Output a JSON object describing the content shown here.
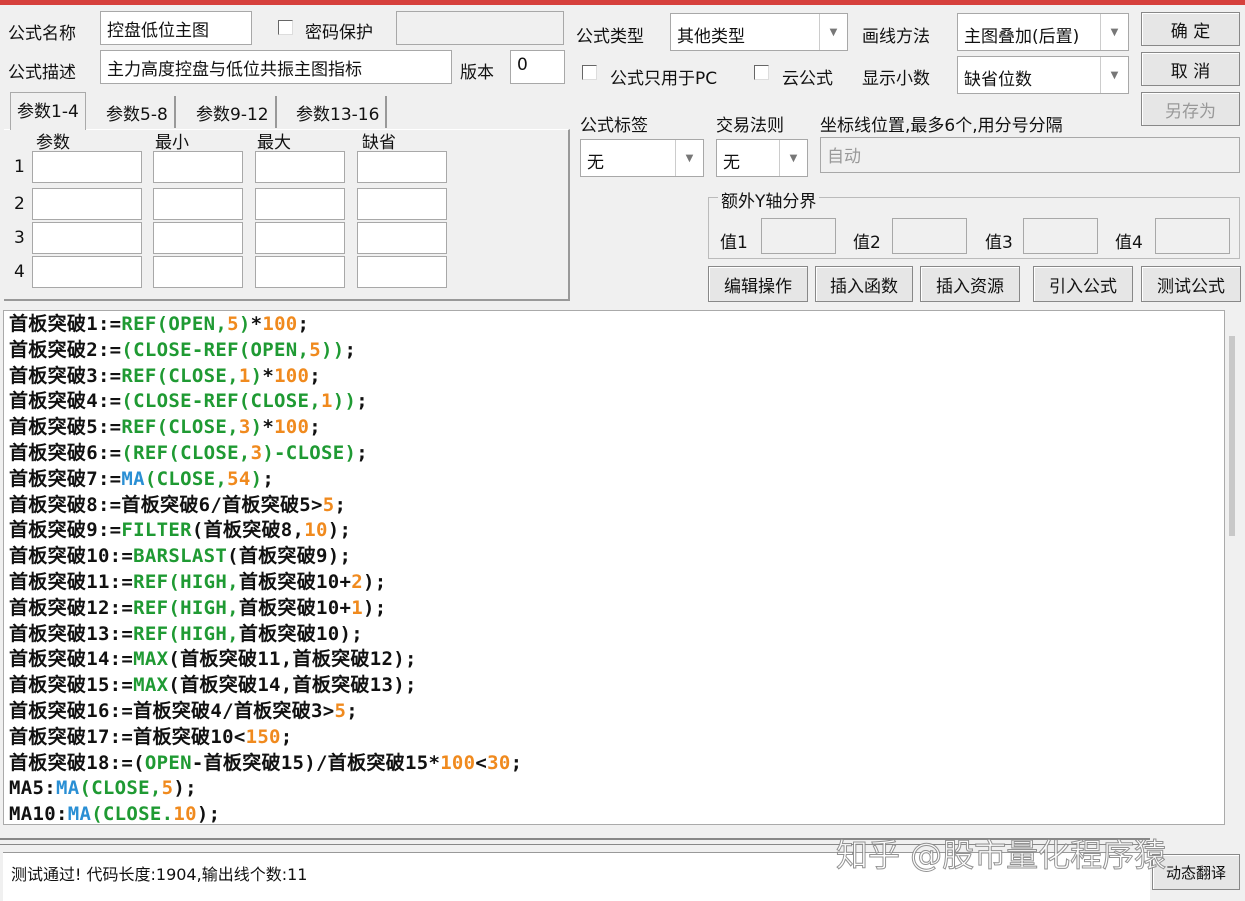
{
  "form": {
    "name_label": "公式名称",
    "name_value": "控盘低位主图",
    "password_label": "密码保护",
    "password_value": "",
    "desc_label": "公式描述",
    "desc_value": "主力高度控盘与低位共振主图指标",
    "version_label": "版本",
    "version_value": "0",
    "type_label": "公式类型",
    "type_value": "其他类型",
    "draw_label": "画线方法",
    "draw_value": "主图叠加(后置)",
    "pc_only_label": "公式只用于PC",
    "cloud_label": "云公式",
    "decimal_label": "显示小数",
    "decimal_value": "缺省位数",
    "tag_label": "公式标签",
    "tag_value": "无",
    "rule_label": "交易法则",
    "rule_value": "无",
    "axis_label": "坐标线位置,最多6个,用分号分隔",
    "axis_placeholder": "自动",
    "yaxis_group": "额外Y轴分界",
    "y_labels": [
      "值1",
      "值2",
      "值3",
      "值4"
    ]
  },
  "buttons": {
    "ok": "确  定",
    "cancel": "取  消",
    "save_as": "另存为",
    "edit": "编辑操作",
    "insert_func": "插入函数",
    "insert_res": "插入资源",
    "import": "引入公式",
    "test": "测试公式",
    "translate": "动态翻译"
  },
  "params": {
    "tabs": [
      "参数1-4",
      "参数5-8",
      "参数9-12",
      "参数13-16"
    ],
    "headers": [
      "参数",
      "最小",
      "最大",
      "缺省"
    ],
    "rows": [
      "1",
      "2",
      "3",
      "4"
    ]
  },
  "code_lines": [
    [
      [
        "首板突破1:=",
        "b"
      ],
      [
        "REF(OPEN,",
        "g"
      ],
      [
        "5",
        "o"
      ],
      [
        ")",
        "g"
      ],
      [
        "*",
        "b"
      ],
      [
        "100",
        "o"
      ],
      [
        ";",
        "b"
      ]
    ],
    [
      [
        "首板突破2:=",
        "b"
      ],
      [
        "(CLOSE-REF(OPEN,",
        "g"
      ],
      [
        "5",
        "o"
      ],
      [
        "))",
        "g"
      ],
      [
        ";",
        "b"
      ]
    ],
    [
      [
        "首板突破3:=",
        "b"
      ],
      [
        "REF(CLOSE,",
        "g"
      ],
      [
        "1",
        "o"
      ],
      [
        ")",
        "g"
      ],
      [
        "*",
        "b"
      ],
      [
        "100",
        "o"
      ],
      [
        ";",
        "b"
      ]
    ],
    [
      [
        "首板突破4:=",
        "b"
      ],
      [
        "(CLOSE-REF(CLOSE,",
        "g"
      ],
      [
        "1",
        "o"
      ],
      [
        "))",
        "g"
      ],
      [
        ";",
        "b"
      ]
    ],
    [
      [
        "首板突破5:=",
        "b"
      ],
      [
        "REF(CLOSE,",
        "g"
      ],
      [
        "3",
        "o"
      ],
      [
        ")",
        "g"
      ],
      [
        "*",
        "b"
      ],
      [
        "100",
        "o"
      ],
      [
        ";",
        "b"
      ]
    ],
    [
      [
        "首板突破6:=",
        "b"
      ],
      [
        "(REF(CLOSE,",
        "g"
      ],
      [
        "3",
        "o"
      ],
      [
        ")-CLOSE)",
        "g"
      ],
      [
        ";",
        "b"
      ]
    ],
    [
      [
        "首板突破7:=",
        "b"
      ],
      [
        "MA",
        "c"
      ],
      [
        "(CLOSE,",
        "g"
      ],
      [
        "54",
        "o"
      ],
      [
        ")",
        "g"
      ],
      [
        ";",
        "b"
      ]
    ],
    [
      [
        "首板突破8:=首板突破6/首板突破5>",
        "b"
      ],
      [
        "5",
        "o"
      ],
      [
        ";",
        "b"
      ]
    ],
    [
      [
        "首板突破9:=",
        "b"
      ],
      [
        "FILTER",
        "g"
      ],
      [
        "(首板突破8,",
        "b"
      ],
      [
        "10",
        "o"
      ],
      [
        ");",
        "b"
      ]
    ],
    [
      [
        "首板突破10:=",
        "b"
      ],
      [
        "BARSLAST",
        "g"
      ],
      [
        "(首板突破9);",
        "b"
      ]
    ],
    [
      [
        "首板突破11:=",
        "b"
      ],
      [
        "REF(HIGH,",
        "g"
      ],
      [
        "首板突破10+",
        "b"
      ],
      [
        "2",
        "o"
      ],
      [
        ");",
        "b"
      ]
    ],
    [
      [
        "首板突破12:=",
        "b"
      ],
      [
        "REF(HIGH,",
        "g"
      ],
      [
        "首板突破10+",
        "b"
      ],
      [
        "1",
        "o"
      ],
      [
        ");",
        "b"
      ]
    ],
    [
      [
        "首板突破13:=",
        "b"
      ],
      [
        "REF(HIGH,",
        "g"
      ],
      [
        "首板突破10);",
        "b"
      ]
    ],
    [
      [
        "首板突破14:=",
        "b"
      ],
      [
        "MAX",
        "g"
      ],
      [
        "(首板突破11,首板突破12);",
        "b"
      ]
    ],
    [
      [
        "首板突破15:=",
        "b"
      ],
      [
        "MAX",
        "g"
      ],
      [
        "(首板突破14,首板突破13);",
        "b"
      ]
    ],
    [
      [
        "首板突破16:=首板突破4/首板突破3>",
        "b"
      ],
      [
        "5",
        "o"
      ],
      [
        ";",
        "b"
      ]
    ],
    [
      [
        "首板突破17:=首板突破10<",
        "b"
      ],
      [
        "150",
        "o"
      ],
      [
        ";",
        "b"
      ]
    ],
    [
      [
        "首板突破18:=(",
        "b"
      ],
      [
        "OPEN",
        "g"
      ],
      [
        "-首板突破15)/首板突破15*",
        "b"
      ],
      [
        "100",
        "o"
      ],
      [
        "<",
        "b"
      ],
      [
        "30",
        "o"
      ],
      [
        ";",
        "b"
      ]
    ],
    [
      [
        "MA5:",
        "b"
      ],
      [
        "MA",
        "c"
      ],
      [
        "(CLOSE,",
        "g"
      ],
      [
        "5",
        "o"
      ],
      [
        ");",
        "b"
      ]
    ],
    [
      [
        "MA10:",
        "b"
      ],
      [
        "MA",
        "c"
      ],
      [
        "(CLOSE.",
        "g"
      ],
      [
        "10",
        "o"
      ],
      [
        ");",
        "b"
      ]
    ]
  ],
  "status": "测试通过! 代码长度:1904,输出线个数:11",
  "watermark": "知乎 @股市量化程序猿"
}
